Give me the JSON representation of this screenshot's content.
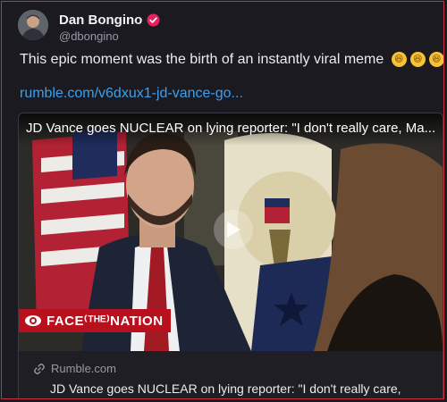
{
  "author": {
    "display_name": "Dan Bongino",
    "handle": "@dbongino",
    "verified": true
  },
  "post": {
    "text": "This epic moment was the birth of an instantly viral meme",
    "emojis": [
      "rolling-on-floor-laughing",
      "rolling-on-floor-laughing",
      "rolling-on-floor-laughing"
    ],
    "link_text": "rumble.com/v6dxux1-jd-vance-go..."
  },
  "embed": {
    "video_title": "JD Vance goes NUCLEAR on lying reporter: \"I don't really care, Ma...",
    "network_badge": "FACE THE NATION",
    "network_badge_display": "FACE⁽ᵀᴴᴱ⁾NATION",
    "domain": "Rumble.com",
    "card_title": "JD Vance goes NUCLEAR on lying reporter: \"I don't really care, Margaret\""
  },
  "colors": {
    "link": "#3aa0f0",
    "border_accent": "#c8313f",
    "verified_badge": "#e0245e",
    "badge_red": "#b8101d"
  }
}
